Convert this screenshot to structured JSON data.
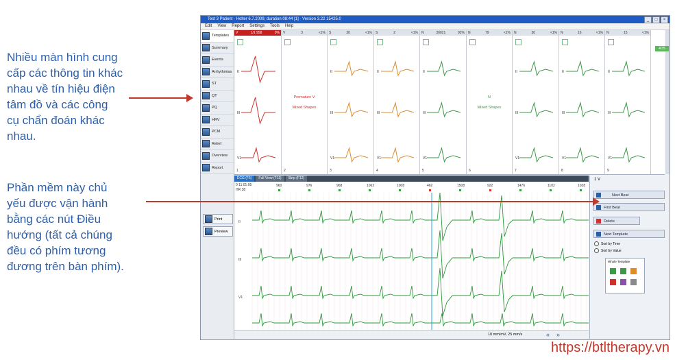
{
  "annotations": {
    "screens_text": "Nhiều màn hình cung cấp các thông tin khác nhau về tín hiệu điện tâm đồ và các công cụ chẩn đoán khác nhau.",
    "navigation_text": "Phần mềm này chủ yếu được vận hành bằng các nút Điều hướng (tất cả chúng đều có phím tương đương trên bàn phím)."
  },
  "watermark": "https://btltherapy.vn",
  "app": {
    "title": "Test 3 Patient · Holter 6.7.2009, duration 08:44 [1] · Version 3.22 15425.0",
    "menu": [
      "Edit",
      "View",
      "Report",
      "Settings",
      "Tools",
      "Help"
    ],
    "nav": [
      "Templates",
      "Summary",
      "Events",
      "Arrhythmias",
      "ST",
      "QT",
      "PQ",
      "HRV",
      "PCM",
      "Relief",
      "Overview",
      "Report"
    ],
    "print_label": "Print",
    "preview_label": "Preview",
    "templates": [
      {
        "label": "V",
        "count": "1/1 958",
        "pct": "0%",
        "num": "1"
      },
      {
        "label": "V",
        "count": "3",
        "pct": "<1%",
        "num": "2",
        "text1": "Premature V",
        "text2": "Mixed Shapes"
      },
      {
        "label": "S",
        "count": "30",
        "pct": "<1%",
        "num": "3"
      },
      {
        "label": "S",
        "count": "2",
        "pct": "<1%",
        "num": "4"
      },
      {
        "label": "N",
        "count": "30021",
        "pct": "92%",
        "num": "5"
      },
      {
        "label": "N",
        "count": "79",
        "pct": "<1%",
        "num": "6",
        "text1": "N",
        "text2": "Mixed Shapes"
      },
      {
        "label": "N",
        "count": "30",
        "pct": "<1%",
        "num": "7"
      },
      {
        "label": "N",
        "count": "16",
        "pct": "<1%",
        "num": "8"
      },
      {
        "label": "N",
        "count": "15",
        "pct": "<1%",
        "num": "9"
      }
    ],
    "lead_labels": [
      "II",
      "III",
      "V1"
    ],
    "viewer_tabs": [
      "ECG (F5)",
      "Full View (F11)",
      "Strip (F12)"
    ],
    "strip_info": [
      "0 11:01:05",
      "HR 38"
    ],
    "rr_values": [
      "960",
      "976",
      "968",
      "1062",
      "1008",
      "462",
      "1508",
      "922",
      "1476",
      "1102",
      "1028"
    ],
    "bottom_speed": "10 mm/mV, 25 mm/s",
    "right": {
      "title": "1 V",
      "next_beat": "Next Beat",
      "first_beat": "First Beat",
      "delete": "Delete",
      "next_template": "Next Template",
      "sort_time": "Sort by Time",
      "sort_value": "Sort by Value",
      "whole_template": "Whole Template"
    },
    "counter": "4/35"
  },
  "colors": {
    "annotation": "#2e5fa8",
    "arrow": "#c0392b",
    "ecg_normal": "#2a9a3a",
    "ecg_ventricular": "#d0312d"
  }
}
